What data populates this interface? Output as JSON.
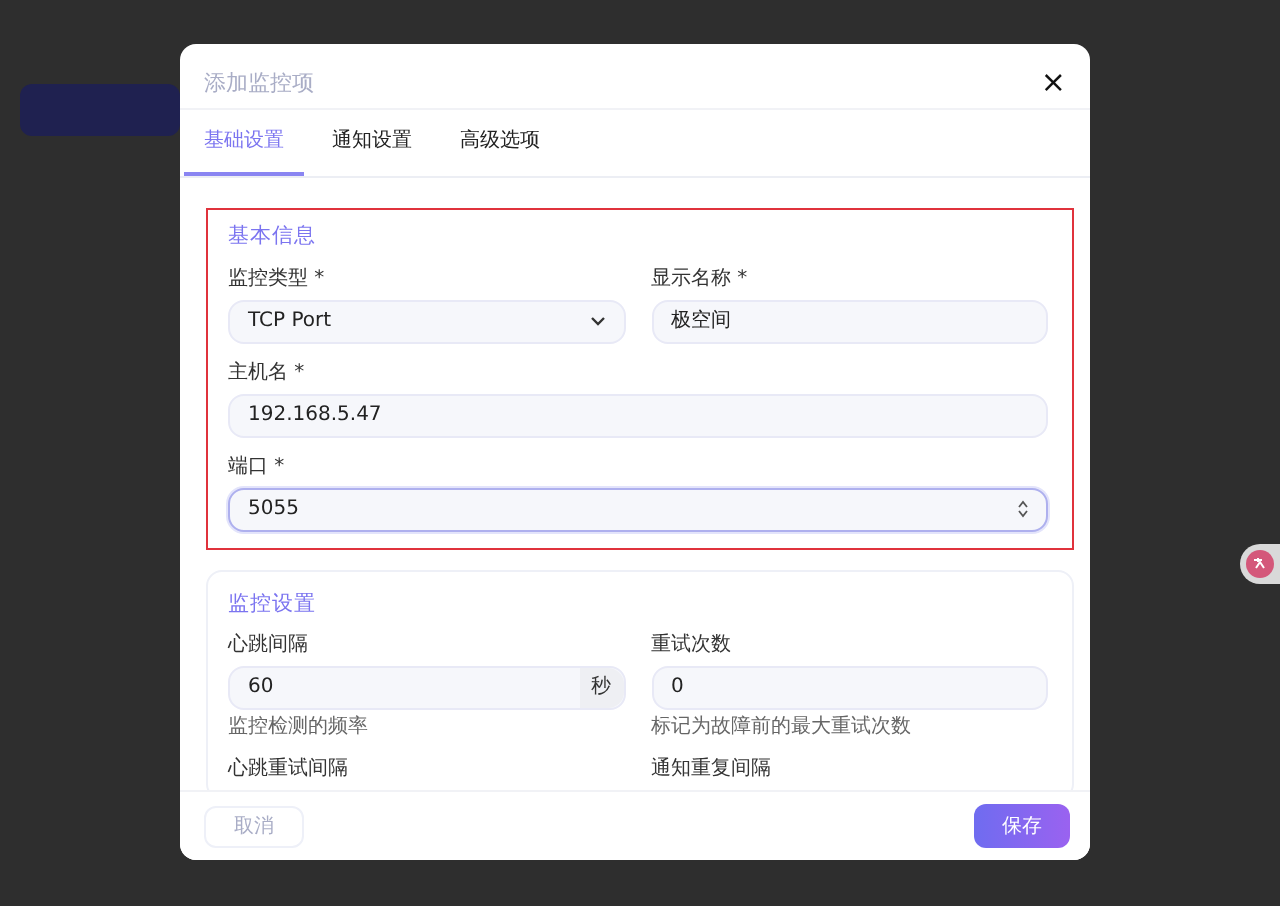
{
  "dialog": {
    "title": "添加监控项",
    "close": "×",
    "tabs": [
      {
        "label": "基础设置",
        "selected": true
      },
      {
        "label": "通知设置",
        "selected": false
      },
      {
        "label": "高级选项",
        "selected": false
      }
    ],
    "sections": [
      {
        "title": "基本信息",
        "highlighted": true,
        "rows": [
          [
            {
              "label": "监控类型 *",
              "kind": "select",
              "value": "TCP Port",
              "focused": false
            },
            {
              "label": "显示名称 *",
              "kind": "text",
              "value": "极空间",
              "focused": false
            }
          ],
          [
            {
              "label": "主机名 *",
              "kind": "text",
              "value": "192.168.5.47",
              "focused": false
            }
          ],
          [
            {
              "label": "端口 *",
              "kind": "number",
              "value": "5055",
              "focused": true
            }
          ]
        ]
      },
      {
        "title": "监控设置",
        "highlighted": false,
        "rows": [
          [
            {
              "label": "心跳间隔",
              "kind": "suffix",
              "value": "60",
              "suffix": "秒",
              "hint": "监控检测的频率",
              "focused": false
            },
            {
              "label": "重试次数",
              "kind": "text",
              "value": "0",
              "hint": "标记为故障前的最大重试次数",
              "focused": false
            }
          ],
          [
            {
              "label": "心跳重试间隔",
              "kind": "label"
            },
            {
              "label": "通知重复间隔",
              "kind": "label"
            }
          ]
        ]
      }
    ],
    "buttons": [
      {
        "label": "取消",
        "kind": "secondary"
      },
      {
        "label": "保存",
        "kind": "primary"
      }
    ]
  }
}
